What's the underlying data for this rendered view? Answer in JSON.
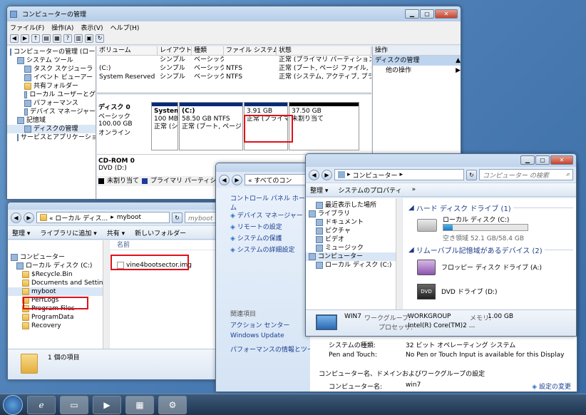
{
  "cm": {
    "title": "コンピューターの管理",
    "menu": [
      "ファイル(F)",
      "操作(A)",
      "表示(V)",
      "ヘルプ(H)"
    ],
    "tree": [
      {
        "label": "コンピューターの管理 (ローカ",
        "indent": 0,
        "icon": "computer-icon"
      },
      {
        "label": "システム ツール",
        "indent": 1,
        "icon": "tools-icon"
      },
      {
        "label": "タスク スケジューラ",
        "indent": 2,
        "icon": "clock-icon"
      },
      {
        "label": "イベント ビューアー",
        "indent": 2,
        "icon": "event-icon"
      },
      {
        "label": "共有フォルダー",
        "indent": 2,
        "icon": "folder-icon"
      },
      {
        "label": "ローカル ユーザーとグ",
        "indent": 2,
        "icon": "users-icon"
      },
      {
        "label": "パフォーマンス",
        "indent": 2,
        "icon": "performance-icon"
      },
      {
        "label": "デバイス マネージャー",
        "indent": 2,
        "icon": "device-icon"
      },
      {
        "label": "記憶域",
        "indent": 1,
        "icon": "storage-icon"
      },
      {
        "label": "ディスクの管理",
        "indent": 2,
        "icon": "disk-icon"
      },
      {
        "label": "サービスとアプリケーショ",
        "indent": 1,
        "icon": "services-icon"
      }
    ],
    "columns": [
      "ボリューム",
      "レイアウト",
      "種類",
      "ファイル システム",
      "状態"
    ],
    "volumes": [
      [
        "",
        "シンプル",
        "ベーシック",
        "",
        "正常 (プライマリ パーティション)"
      ],
      [
        "(C:)",
        "シンプル",
        "ベーシック",
        "NTFS",
        "正常 (ブート, ページ ファイル, クラッ"
      ],
      [
        "System Reserved",
        "シンプル",
        "ベーシック",
        "NTFS",
        "正常 (システム, アクティブ, プライマ"
      ]
    ],
    "disk0": {
      "name": "ディスク 0",
      "type": "ベーシック",
      "size": "100.00 GB",
      "status": "オンライン"
    },
    "partitions": [
      {
        "name": "System",
        "size": "100 MB",
        "status": "正常 (シ"
      },
      {
        "name": "(C:)",
        "size": "58.50 GB NTFS",
        "status": "正常 (ブート, ページ フ"
      },
      {
        "name": "",
        "size": "3.91 GB",
        "status": "正常 (プライマリ"
      },
      {
        "name": "",
        "size": "37.50 GB",
        "status": "未割り当て"
      }
    ],
    "cdrom": {
      "name": "CD-ROM 0",
      "drive": "DVD (D:)"
    },
    "legend": [
      "未割り当て",
      "プライマリ パーティション"
    ],
    "actions_title": "操作",
    "actions_section": "ディスクの管理",
    "actions_other": "他の操作"
  },
  "exp": {
    "address": [
      "« ローカル ディス...",
      "myboot"
    ],
    "search": "myboot の検",
    "cmds": [
      "整理 ▾",
      "ライブラリに追加 ▾",
      "共有 ▾",
      "新しいフォルダー"
    ],
    "tree": [
      {
        "label": "コンピューター",
        "indent": 0,
        "icon": "computer-icon"
      },
      {
        "label": "ローカル ディスク (C:)",
        "indent": 1,
        "icon": "drive-icon"
      },
      {
        "label": "$Recycle.Bin",
        "indent": 2,
        "icon": "folder-icon"
      },
      {
        "label": "Documents and Setting",
        "indent": 2,
        "icon": "folder-icon"
      },
      {
        "label": "myboot",
        "indent": 2,
        "icon": "folder-icon"
      },
      {
        "label": "PerfLogs",
        "indent": 2,
        "icon": "folder-icon"
      },
      {
        "label": "Program Files",
        "indent": 2,
        "icon": "folder-icon"
      },
      {
        "label": "ProgramData",
        "indent": 2,
        "icon": "folder-icon"
      },
      {
        "label": "Recovery",
        "indent": 2,
        "icon": "folder-icon"
      }
    ],
    "col_name": "名前",
    "file": "vine4bootsector.img",
    "status": "1 個の項目"
  },
  "cp": {
    "address": "« すべてのコン",
    "home": "コントロール パネル ホーム",
    "links": [
      "デバイス マネージャー",
      "リモートの設定",
      "システムの保護",
      "システムの詳細設定"
    ],
    "related_title": "関連項目",
    "related": [
      "アクション センター",
      "Windows Update",
      "パフォーマンスの情報とツール"
    ],
    "sys_type_label": "システムの種類:",
    "sys_type": "32 ビット オペレーティング システム",
    "pen_label": "Pen and Touch:",
    "pen": "No Pen or Touch Input is available for this Display",
    "section": "コンピューター名、ドメインおよびワークグループの設定",
    "pcname_label": "コンピューター名:",
    "pcname": "win7",
    "change": "設定の変更"
  },
  "comp": {
    "address": "コンピューター",
    "search": "コンピューター の検索",
    "cmds": [
      "整理 ▾",
      "システムのプロパティ",
      "»"
    ],
    "nav": [
      {
        "label": "最近表示した場所",
        "indent": 1,
        "icon": "recent-icon"
      },
      {
        "label": "ライブラリ",
        "indent": 0,
        "icon": "library-icon"
      },
      {
        "label": "ドキュメント",
        "indent": 1,
        "icon": "documents-icon"
      },
      {
        "label": "ピクチャ",
        "indent": 1,
        "icon": "pictures-icon"
      },
      {
        "label": "ビデオ",
        "indent": 1,
        "icon": "videos-icon"
      },
      {
        "label": "ミュージック",
        "indent": 1,
        "icon": "music-icon"
      },
      {
        "label": "コンピューター",
        "indent": 0,
        "icon": "computer-icon"
      },
      {
        "label": "ローカル ディスク (C:)",
        "indent": 1,
        "icon": "drive-icon"
      }
    ],
    "hdd_group": "ハード ディスク ドライブ (1)",
    "c_name": "ローカル ディスク (C:)",
    "c_free": "空き領域 52.1 GB/58.4 GB",
    "c_used_fraction": 0.11,
    "removable_group": "リムーバブル記憶域があるデバイス (2)",
    "floppy": "フロッピー ディスク ドライブ (A:)",
    "dvd": "DVD ドライブ (D:)",
    "pc": "WIN7",
    "wg_label": "ワークグループ:",
    "wg": "WORKGROUP",
    "mem_label": "メモリ:",
    "mem": "1.00 GB",
    "cpu_label": "プロセッサ:",
    "cpu": "Intel(R) Core(TM)2 ..."
  }
}
